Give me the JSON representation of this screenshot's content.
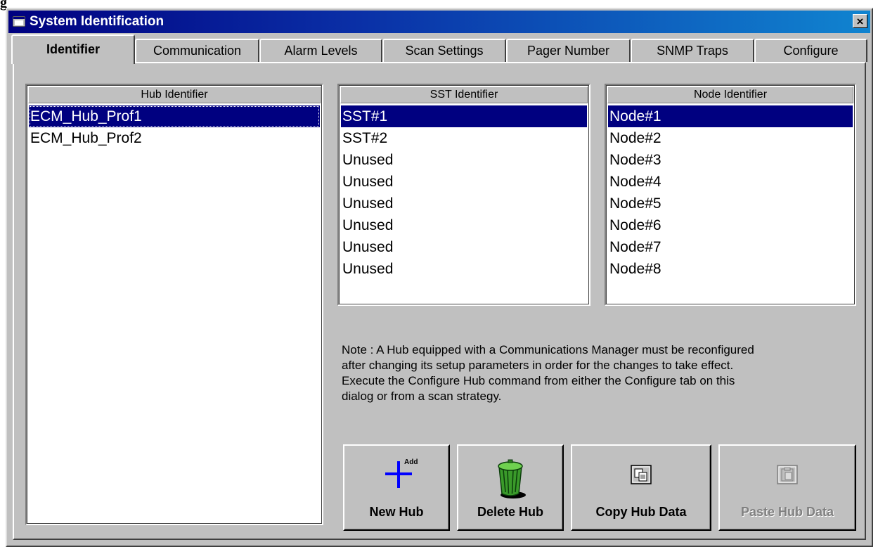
{
  "corner_label": "g",
  "window": {
    "title": "System Identification",
    "close_symbol": "×"
  },
  "tabs": [
    {
      "label": "Identifier",
      "active": true
    },
    {
      "label": "Communication",
      "active": false
    },
    {
      "label": "Alarm Levels",
      "active": false
    },
    {
      "label": "Scan Settings",
      "active": false
    },
    {
      "label": "Pager Number",
      "active": false
    },
    {
      "label": "SNMP Traps",
      "active": false
    },
    {
      "label": "Configure",
      "active": false
    }
  ],
  "hub_list": {
    "header": "Hub Identifier",
    "items": [
      "ECM_Hub_Prof1",
      "ECM_Hub_Prof2"
    ],
    "selected_index": 0
  },
  "sst_list": {
    "header": "SST Identifier",
    "items": [
      "SST#1",
      "SST#2",
      "Unused",
      "Unused",
      "Unused",
      "Unused",
      "Unused",
      "Unused"
    ],
    "selected_index": 0
  },
  "node_list": {
    "header": "Node Identifier",
    "items": [
      "Node#1",
      "Node#2",
      "Node#3",
      "Node#4",
      "Node#5",
      "Node#6",
      "Node#7",
      "Node#8"
    ],
    "selected_index": 0
  },
  "note": {
    "lines": [
      "Note : A Hub equipped with a Communications Manager must be reconfigured",
      "after changing its setup parameters in order for the changes to take effect.",
      "Execute the Configure Hub command from either the Configure tab on this",
      "dialog or from a scan strategy."
    ]
  },
  "buttons": {
    "new_hub": {
      "label": "New Hub",
      "icon": "add-plus-icon",
      "icon_text": "Add"
    },
    "delete_hub": {
      "label": "Delete Hub",
      "icon": "trash-can-icon"
    },
    "copy_hub": {
      "label": "Copy Hub Data",
      "icon": "copy-icon"
    },
    "paste_hub": {
      "label": "Paste Hub Data",
      "icon": "paste-icon",
      "disabled": true
    }
  }
}
